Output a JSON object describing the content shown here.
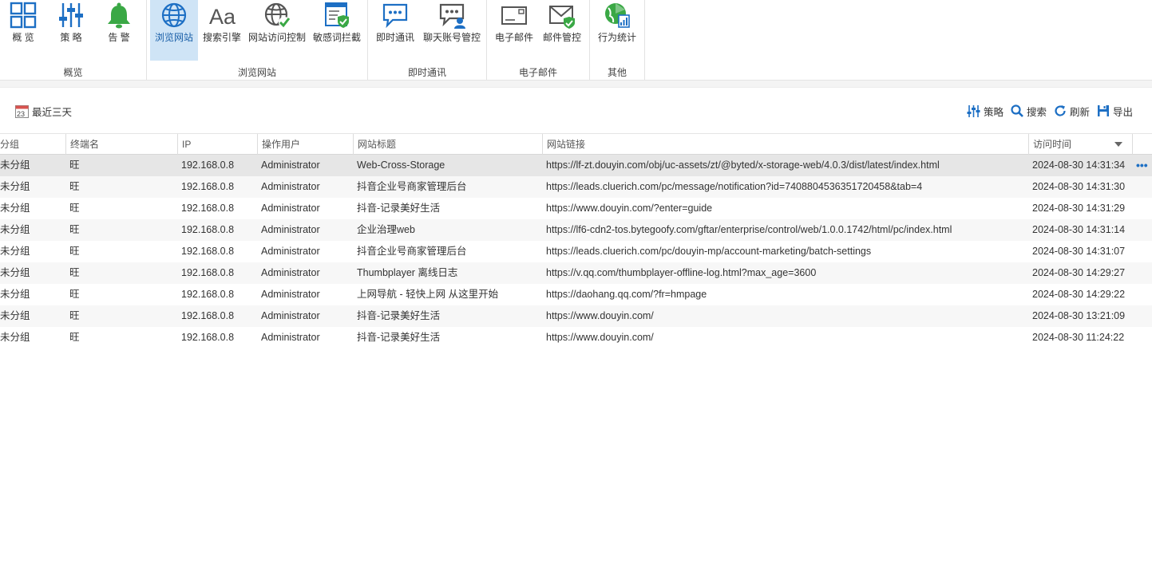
{
  "ribbon": {
    "groups": [
      {
        "label": "概览",
        "buttons": [
          {
            "label": "概 览",
            "icon": "overview-grid-icon"
          },
          {
            "label": "策 略",
            "icon": "policy-sliders-icon"
          },
          {
            "label": "告 警",
            "icon": "alarm-bell-icon"
          }
        ]
      },
      {
        "label": "浏览网站",
        "buttons": [
          {
            "label": "浏览网站",
            "icon": "globe-icon",
            "active": true
          },
          {
            "label": "搜索引擎",
            "icon": "search-engine-aa-icon"
          },
          {
            "label": "网站访问控制",
            "icon": "globe-check-icon"
          },
          {
            "label": "敏感词拦截",
            "icon": "sensitive-word-shield-icon"
          }
        ]
      },
      {
        "label": "即时通讯",
        "buttons": [
          {
            "label": "即时通讯",
            "icon": "chat-bubble-icon"
          },
          {
            "label": "聊天账号管控",
            "icon": "chat-account-icon"
          }
        ]
      },
      {
        "label": "电子邮件",
        "buttons": [
          {
            "label": "电子邮件",
            "icon": "email-icon"
          },
          {
            "label": "邮件管控",
            "icon": "email-check-icon"
          }
        ]
      },
      {
        "label": "其他",
        "buttons": [
          {
            "label": "行为统计",
            "icon": "behavior-stats-icon"
          }
        ]
      }
    ]
  },
  "toolbar": {
    "date_filter": "最近三天",
    "date_icon_text": "23",
    "policy": "策略",
    "search": "搜索",
    "refresh": "刷新",
    "export": "导出"
  },
  "table": {
    "columns": [
      "分组",
      "终端名",
      "IP",
      "操作用户",
      "网站标题",
      "网站链接",
      "访问时间"
    ],
    "rows": [
      [
        "未分组",
        "旺",
        "192.168.0.8",
        "Administrator",
        "Web-Cross-Storage",
        "https://lf-zt.douyin.com/obj/uc-assets/zt/@byted/x-storage-web/4.0.3/dist/latest/index.html",
        "2024-08-30 14:31:34"
      ],
      [
        "未分组",
        "旺",
        "192.168.0.8",
        "Administrator",
        "抖音企业号商家管理后台",
        "https://leads.cluerich.com/pc/message/notification?id=7408804536351720458&tab=4",
        "2024-08-30 14:31:30"
      ],
      [
        "未分组",
        "旺",
        "192.168.0.8",
        "Administrator",
        "抖音-记录美好生活",
        "https://www.douyin.com/?enter=guide",
        "2024-08-30 14:31:29"
      ],
      [
        "未分组",
        "旺",
        "192.168.0.8",
        "Administrator",
        "企业治理web",
        "https://lf6-cdn2-tos.bytegoofy.com/gftar/enterprise/control/web/1.0.0.1742/html/pc/index.html",
        "2024-08-30 14:31:14"
      ],
      [
        "未分组",
        "旺",
        "192.168.0.8",
        "Administrator",
        "抖音企业号商家管理后台",
        "https://leads.cluerich.com/pc/douyin-mp/account-marketing/batch-settings",
        "2024-08-30 14:31:07"
      ],
      [
        "未分组",
        "旺",
        "192.168.0.8",
        "Administrator",
        "Thumbplayer 离线日志",
        "https://v.qq.com/thumbplayer-offline-log.html?max_age=3600",
        "2024-08-30 14:29:27"
      ],
      [
        "未分组",
        "旺",
        "192.168.0.8",
        "Administrator",
        "上网导航 - 轻快上网 从这里开始",
        "https://daohang.qq.com/?fr=hmpage",
        "2024-08-30 14:29:22"
      ],
      [
        "未分组",
        "旺",
        "192.168.0.8",
        "Administrator",
        "抖音-记录美好生活",
        "https://www.douyin.com/",
        "2024-08-30 13:21:09"
      ],
      [
        "未分组",
        "旺",
        "192.168.0.8",
        "Administrator",
        "抖音-记录美好生活",
        "https://www.douyin.com/",
        "2024-08-30 11:24:22"
      ]
    ],
    "more": "•••"
  },
  "colors": {
    "accent": "#1d6fc4",
    "active_tab": "#cfe4f6",
    "selected_row": "#e6e6e6",
    "alt_row": "#f7f7f7",
    "green": "#3aa845"
  }
}
